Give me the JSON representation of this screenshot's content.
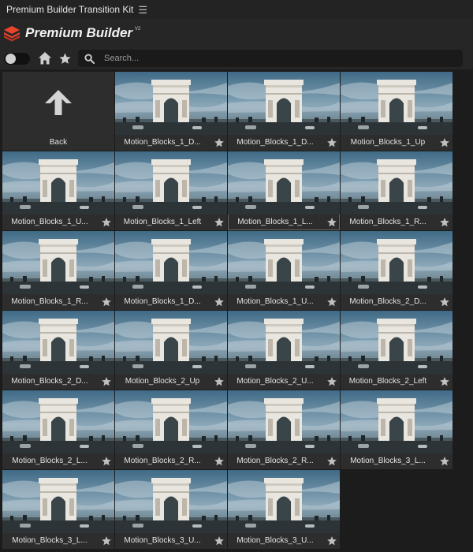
{
  "window": {
    "title": "Premium Builder Transition Kit",
    "menu_icon": "hamburger-icon"
  },
  "brand": {
    "name": "Premium Builder",
    "version": "V2",
    "logo_icon": "layers-logo-icon"
  },
  "toolbar": {
    "toggle_state": "off",
    "home_icon": "home-icon",
    "favorites_icon": "star-icon",
    "search": {
      "icon": "search-icon",
      "placeholder": "Search...",
      "value": ""
    }
  },
  "colors": {
    "accent": "#e8452c",
    "background": "#1e1e1e",
    "cell": "#2d2d2d"
  },
  "grid": {
    "back": {
      "label": "Back",
      "icon": "arrow-up-icon"
    },
    "items": [
      {
        "label": "Motion_Blocks_1_D..."
      },
      {
        "label": "Motion_Blocks_1_D..."
      },
      {
        "label": "Motion_Blocks_1_Up"
      },
      {
        "label": "Motion_Blocks_1_U..."
      },
      {
        "label": "Motion_Blocks_1_Left"
      },
      {
        "label": "Motion_Blocks_1_L..."
      },
      {
        "label": "Motion_Blocks_1_R..."
      },
      {
        "label": "Motion_Blocks_1_R..."
      },
      {
        "label": "Motion_Blocks_1_D..."
      },
      {
        "label": "Motion_Blocks_1_U..."
      },
      {
        "label": "Motion_Blocks_2_D..."
      },
      {
        "label": "Motion_Blocks_2_D..."
      },
      {
        "label": "Motion_Blocks_2_Up"
      },
      {
        "label": "Motion_Blocks_2_U..."
      },
      {
        "label": "Motion_Blocks_2_Left"
      },
      {
        "label": "Motion_Blocks_2_L..."
      },
      {
        "label": "Motion_Blocks_2_R..."
      },
      {
        "label": "Motion_Blocks_2_R..."
      },
      {
        "label": "Motion_Blocks_3_L..."
      },
      {
        "label": "Motion_Blocks_3_L..."
      },
      {
        "label": "Motion_Blocks_3_U..."
      },
      {
        "label": "Motion_Blocks_3_U..."
      }
    ]
  }
}
